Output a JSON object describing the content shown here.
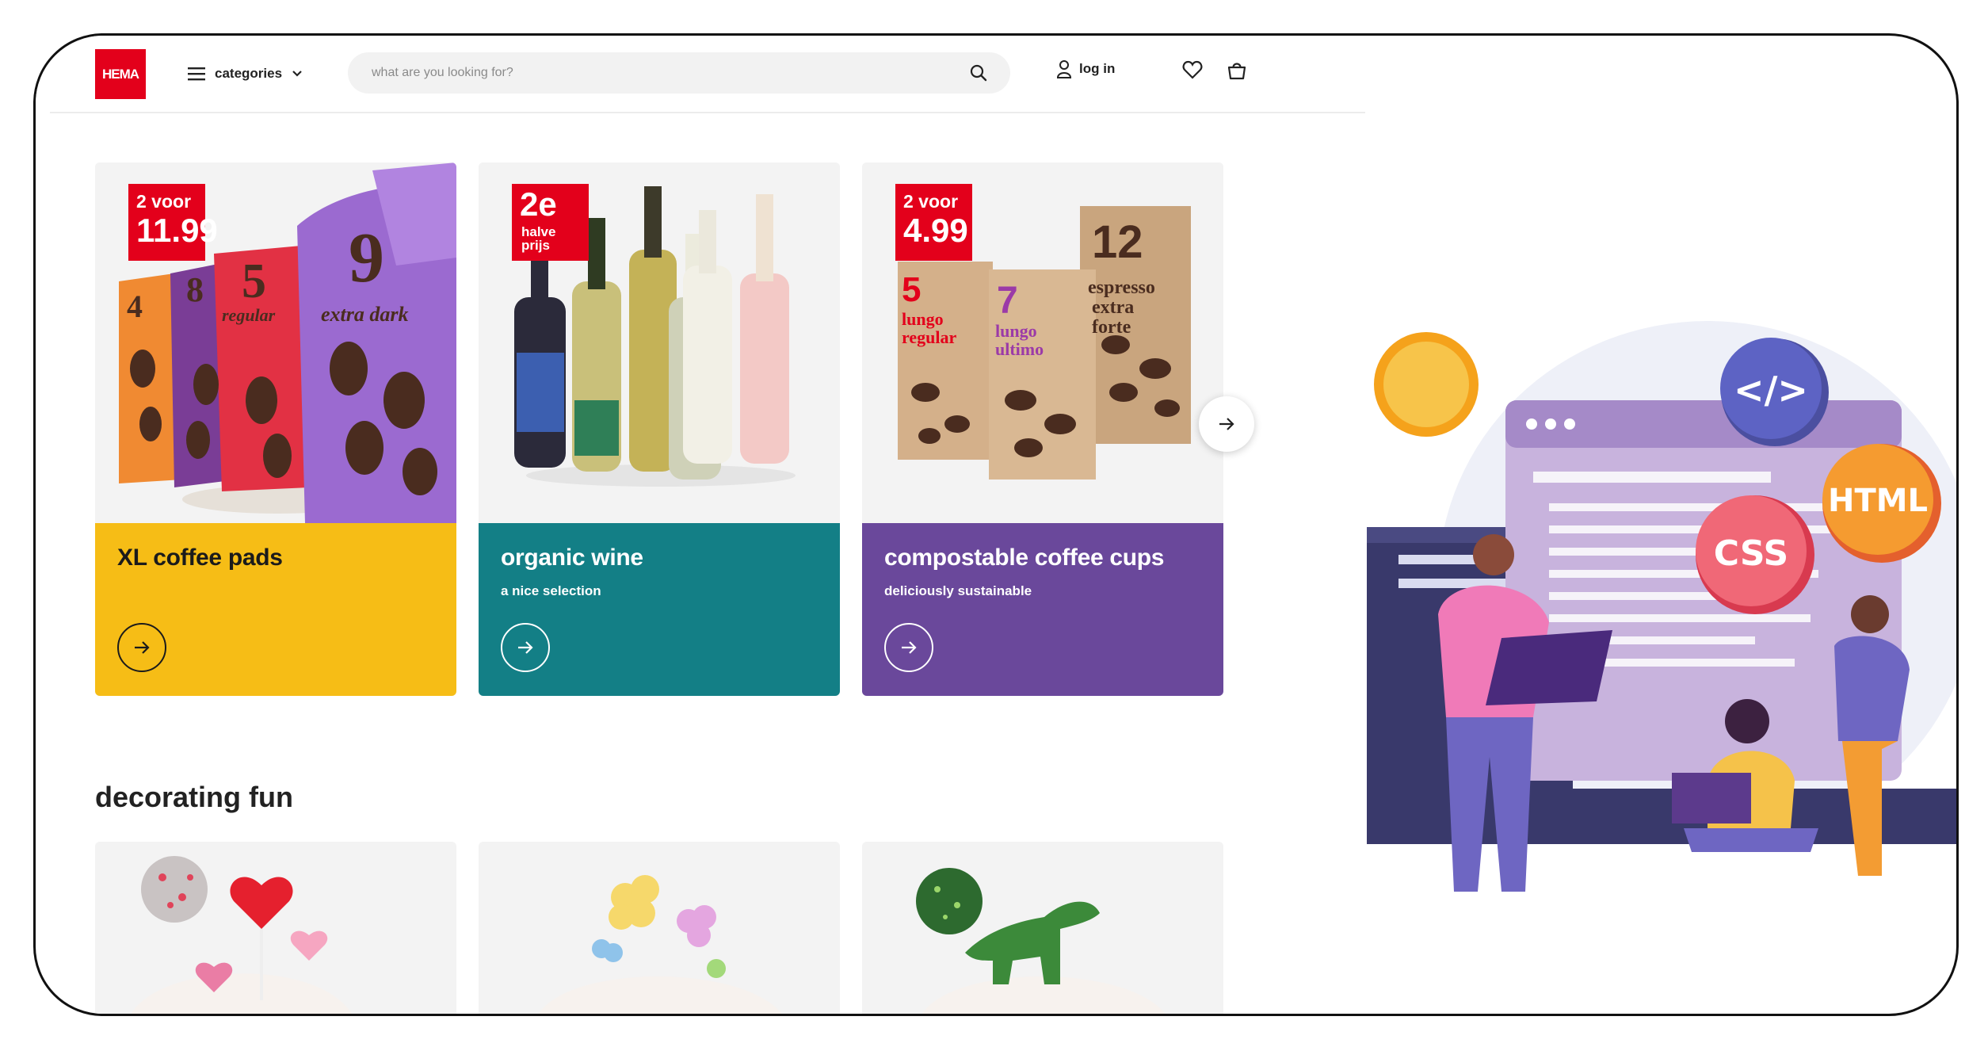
{
  "header": {
    "logo": "HEMA",
    "categories_label": "categories",
    "search_placeholder": "what are you looking for?",
    "login_label": "log in"
  },
  "promos": [
    {
      "title": "XL coffee pads",
      "subtitle": "",
      "badge": {
        "line1": "2 voor",
        "line2": "11.99"
      },
      "color": "#f6bd16"
    },
    {
      "title": "organic wine",
      "subtitle": "a nice selection",
      "badge": {
        "line1": "2e",
        "line2": "halve prijs"
      },
      "color": "#137f86"
    },
    {
      "title": "compostable coffee cups",
      "subtitle": "deliciously sustainable",
      "badge": {
        "line1": "2 voor",
        "line2": "4.99"
      },
      "color": "#6a489b"
    }
  ],
  "section": {
    "title": "decorating fun"
  },
  "illustration": {
    "code_tag": "</>",
    "html_tag": "HTML",
    "css_tag": "CSS"
  },
  "icons": {
    "menu": "hamburger-icon",
    "chevron": "chevron-down-icon",
    "search": "search-icon",
    "user": "user-icon",
    "wishlist": "heart-icon",
    "basket": "basket-icon",
    "arrow": "arrow-right-icon"
  },
  "colors": {
    "brand_red": "#e3001b",
    "yellow": "#f6bd16",
    "teal": "#137f86",
    "purple": "#6a489b"
  }
}
